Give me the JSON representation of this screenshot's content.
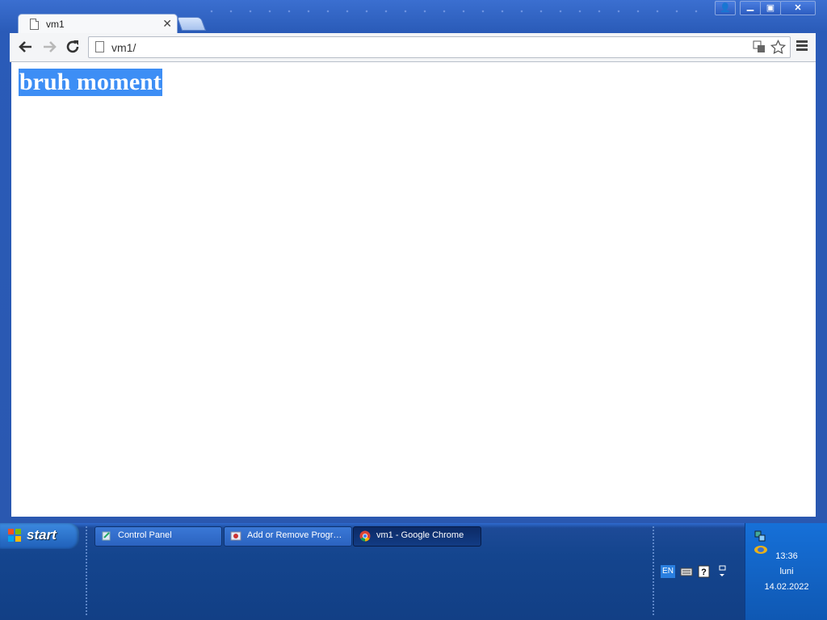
{
  "browser": {
    "tab": {
      "title": "vm1"
    },
    "address": {
      "value": "vm1/"
    }
  },
  "page": {
    "heading": "bruh moment",
    "selection_color": "#3d8ef5"
  },
  "taskbar": {
    "start_label": "start",
    "tasks": [
      {
        "label": "Control Panel",
        "icon": "control-panel-icon"
      },
      {
        "label": "Add or Remove Progr…",
        "icon": "add-remove-programs-icon"
      },
      {
        "label": "vm1 - Google Chrome",
        "icon": "chrome-icon",
        "active": true
      }
    ],
    "language": "EN",
    "clock": {
      "time": "13:36",
      "day": "luni",
      "date": "14.02.2022"
    }
  }
}
